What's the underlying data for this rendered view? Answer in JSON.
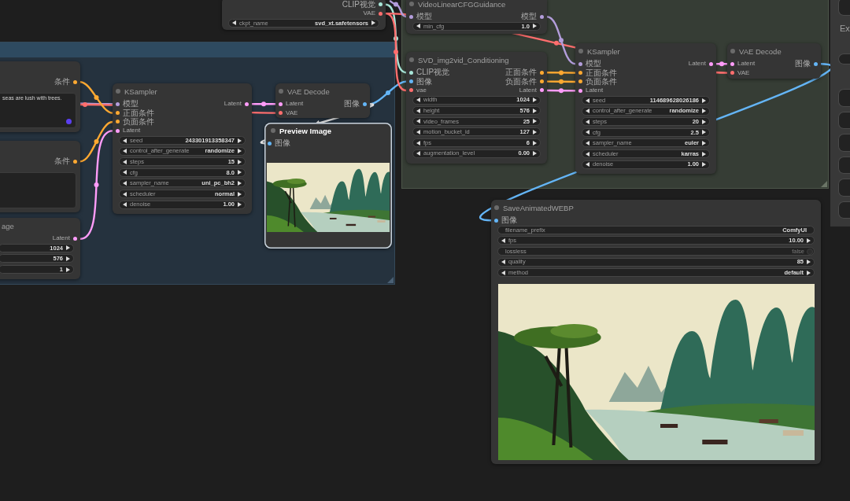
{
  "nodes": [
    {
      "selected": false,
      "outputs": [
        {
          "label": "CLIP视觉",
          "color": "#a8e6d8"
        },
        {
          "label": "VAE",
          "color": "#ff6e6e"
        }
      ],
      "widgets": [
        {
          "kind": "stepper",
          "label": "ckpt_name",
          "value": "svd_xt.safetensors"
        }
      ]
    },
    {
      "title": "VideoLinearCFGGuidance",
      "selected": false,
      "inputs": [
        {
          "label": "模型",
          "color": "#b39ddb"
        }
      ],
      "outputs": [
        {
          "label": "模型",
          "color": "#b39ddb"
        }
      ],
      "widgets": [
        {
          "kind": "stepper",
          "label": "min_cfg",
          "value": "1.0"
        }
      ]
    },
    {
      "title": "SVD_img2vid_Conditioning",
      "selected": false,
      "inputs": [
        {
          "label": "CLIP视觉",
          "color": "#a8e6d8"
        },
        {
          "label": "图像",
          "color": "#64b5f6"
        },
        {
          "label": "vae",
          "color": "#ff6e6e"
        }
      ],
      "outputs": [
        {
          "label": "正面条件",
          "color": "#ffa931"
        },
        {
          "label": "负面条件",
          "color": "#ffa931"
        },
        {
          "label": "Latent",
          "color": "#ff9cf9"
        }
      ],
      "widgets": [
        {
          "kind": "stepper",
          "label": "width",
          "value": "1024"
        },
        {
          "kind": "stepper",
          "label": "height",
          "value": "576"
        },
        {
          "kind": "stepper",
          "label": "video_frames",
          "value": "25"
        },
        {
          "kind": "stepper",
          "label": "motion_bucket_id",
          "value": "127"
        },
        {
          "kind": "stepper",
          "label": "fps",
          "value": "6"
        },
        {
          "kind": "stepper",
          "label": "augmentation_level",
          "value": "0.00"
        }
      ]
    },
    {
      "title": "KSampler",
      "selected": false,
      "inputs": [
        {
          "label": "模型",
          "color": "#b39ddb"
        },
        {
          "label": "正面条件",
          "color": "#ffa931"
        },
        {
          "label": "负面条件",
          "color": "#ffa931"
        },
        {
          "label": "Latent",
          "color": "#ff9cf9"
        }
      ],
      "outputs": [
        {
          "label": "Latent",
          "color": "#ff9cf9"
        }
      ],
      "widgets": [
        {
          "kind": "stepper",
          "label": "seed",
          "value": "114689628026186"
        },
        {
          "kind": "stepper",
          "label": "control_after_generate",
          "value": "randomize"
        },
        {
          "kind": "stepper",
          "label": "steps",
          "value": "20"
        },
        {
          "kind": "stepper",
          "label": "cfg",
          "value": "2.5"
        },
        {
          "kind": "stepper",
          "label": "sampler_name",
          "value": "euler"
        },
        {
          "kind": "stepper",
          "label": "scheduler",
          "value": "karras"
        },
        {
          "kind": "stepper",
          "label": "denoise",
          "value": "1.00"
        }
      ]
    },
    {
      "title": "VAE Decode",
      "selected": false,
      "inputs": [
        {
          "label": "Latent",
          "color": "#ff9cf9"
        },
        {
          "label": "VAE",
          "color": "#ff6e6e"
        }
      ],
      "outputs": [
        {
          "label": "图像",
          "color": "#64b5f6"
        }
      ]
    },
    {
      "selected": false,
      "outputs": [
        {
          "label": "条件",
          "color": "#ffa931"
        }
      ],
      "widgets": [
        {
          "kind": "textarea",
          "value": "seas are lush with trees."
        }
      ]
    },
    {
      "title": "KSampler",
      "selected": false,
      "inputs": [
        {
          "label": "模型",
          "color": "#b39ddb"
        },
        {
          "label": "正面条件",
          "color": "#ffa931"
        },
        {
          "label": "负面条件",
          "color": "#ffa931"
        },
        {
          "label": "Latent",
          "color": "#ff9cf9"
        }
      ],
      "outputs": [
        {
          "label": "Latent",
          "color": "#ff9cf9"
        }
      ],
      "widgets": [
        {
          "kind": "stepper",
          "label": "seed",
          "value": "243301913358347"
        },
        {
          "kind": "stepper",
          "label": "control_after_generate",
          "value": "randomize"
        },
        {
          "kind": "stepper",
          "label": "steps",
          "value": "15"
        },
        {
          "kind": "stepper",
          "label": "cfg",
          "value": "8.0"
        },
        {
          "kind": "stepper",
          "label": "sampler_name",
          "value": "uni_pc_bh2"
        },
        {
          "kind": "stepper",
          "label": "scheduler",
          "value": "normal"
        },
        {
          "kind": "stepper",
          "label": "denoise",
          "value": "1.00"
        }
      ]
    },
    {
      "title": "VAE Decode",
      "selected": false,
      "inputs": [
        {
          "label": "Latent",
          "color": "#ff9cf9"
        },
        {
          "label": "VAE",
          "color": "#ff6e6e"
        }
      ],
      "outputs": [
        {
          "label": "图像",
          "color": "#64b5f6"
        }
      ]
    },
    {
      "title": "Preview Image",
      "selected": true,
      "inputs": [
        {
          "label": "图像",
          "color": "#64b5f6"
        }
      ],
      "preview": {
        "kind": "photo"
      }
    },
    {
      "selected": false,
      "outputs": [
        {
          "label": "条件",
          "color": "#ffa931"
        }
      ],
      "widgets": [
        {
          "kind": "textarea"
        }
      ]
    },
    {
      "title": "age",
      "selected": false,
      "outputs": [
        {
          "label": "Latent",
          "color": "#ff9cf9"
        }
      ],
      "widgets": [
        {
          "kind": "stepper",
          "value": "1024"
        },
        {
          "kind": "stepper",
          "value": "576"
        },
        {
          "kind": "stepper",
          "value": "1"
        }
      ]
    },
    {
      "title": "SaveAnimatedWEBP",
      "selected": false,
      "inputs": [
        {
          "label": "图像",
          "color": "#64b5f6"
        }
      ],
      "widgets": [
        {
          "kind": "text",
          "label": "filename_prefix",
          "value": "ComfyUI"
        },
        {
          "kind": "stepper",
          "label": "fps",
          "value": "10.00"
        },
        {
          "kind": "toggle",
          "label": "lossless",
          "value": "false",
          "on": false
        },
        {
          "kind": "stepper",
          "label": "quality",
          "value": "85"
        },
        {
          "kind": "stepper",
          "label": "method",
          "value": "default"
        }
      ],
      "preview": {
        "kind": "photo"
      }
    }
  ],
  "side_panel": {
    "heading": "Ex"
  }
}
